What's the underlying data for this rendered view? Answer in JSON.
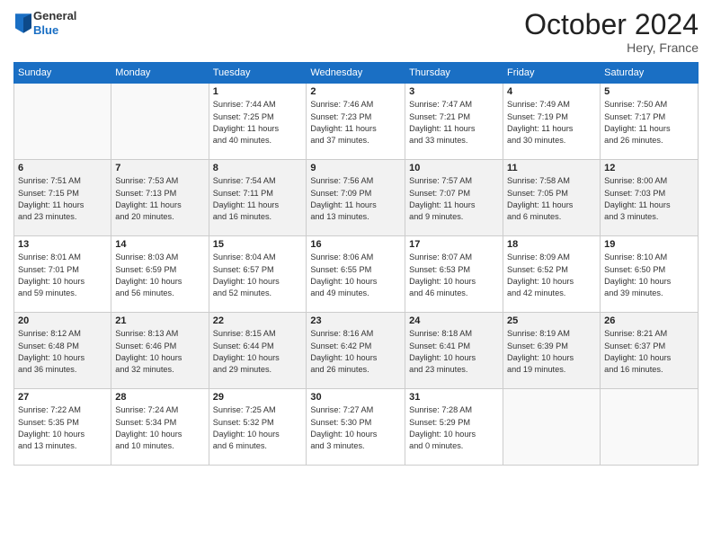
{
  "header": {
    "logo_line1": "General",
    "logo_line2": "Blue",
    "month_title": "October 2024",
    "location": "Hery, France"
  },
  "days_of_week": [
    "Sunday",
    "Monday",
    "Tuesday",
    "Wednesday",
    "Thursday",
    "Friday",
    "Saturday"
  ],
  "weeks": [
    [
      {
        "day": "",
        "info": ""
      },
      {
        "day": "",
        "info": ""
      },
      {
        "day": "1",
        "info": "Sunrise: 7:44 AM\nSunset: 7:25 PM\nDaylight: 11 hours\nand 40 minutes."
      },
      {
        "day": "2",
        "info": "Sunrise: 7:46 AM\nSunset: 7:23 PM\nDaylight: 11 hours\nand 37 minutes."
      },
      {
        "day": "3",
        "info": "Sunrise: 7:47 AM\nSunset: 7:21 PM\nDaylight: 11 hours\nand 33 minutes."
      },
      {
        "day": "4",
        "info": "Sunrise: 7:49 AM\nSunset: 7:19 PM\nDaylight: 11 hours\nand 30 minutes."
      },
      {
        "day": "5",
        "info": "Sunrise: 7:50 AM\nSunset: 7:17 PM\nDaylight: 11 hours\nand 26 minutes."
      }
    ],
    [
      {
        "day": "6",
        "info": "Sunrise: 7:51 AM\nSunset: 7:15 PM\nDaylight: 11 hours\nand 23 minutes."
      },
      {
        "day": "7",
        "info": "Sunrise: 7:53 AM\nSunset: 7:13 PM\nDaylight: 11 hours\nand 20 minutes."
      },
      {
        "day": "8",
        "info": "Sunrise: 7:54 AM\nSunset: 7:11 PM\nDaylight: 11 hours\nand 16 minutes."
      },
      {
        "day": "9",
        "info": "Sunrise: 7:56 AM\nSunset: 7:09 PM\nDaylight: 11 hours\nand 13 minutes."
      },
      {
        "day": "10",
        "info": "Sunrise: 7:57 AM\nSunset: 7:07 PM\nDaylight: 11 hours\nand 9 minutes."
      },
      {
        "day": "11",
        "info": "Sunrise: 7:58 AM\nSunset: 7:05 PM\nDaylight: 11 hours\nand 6 minutes."
      },
      {
        "day": "12",
        "info": "Sunrise: 8:00 AM\nSunset: 7:03 PM\nDaylight: 11 hours\nand 3 minutes."
      }
    ],
    [
      {
        "day": "13",
        "info": "Sunrise: 8:01 AM\nSunset: 7:01 PM\nDaylight: 10 hours\nand 59 minutes."
      },
      {
        "day": "14",
        "info": "Sunrise: 8:03 AM\nSunset: 6:59 PM\nDaylight: 10 hours\nand 56 minutes."
      },
      {
        "day": "15",
        "info": "Sunrise: 8:04 AM\nSunset: 6:57 PM\nDaylight: 10 hours\nand 52 minutes."
      },
      {
        "day": "16",
        "info": "Sunrise: 8:06 AM\nSunset: 6:55 PM\nDaylight: 10 hours\nand 49 minutes."
      },
      {
        "day": "17",
        "info": "Sunrise: 8:07 AM\nSunset: 6:53 PM\nDaylight: 10 hours\nand 46 minutes."
      },
      {
        "day": "18",
        "info": "Sunrise: 8:09 AM\nSunset: 6:52 PM\nDaylight: 10 hours\nand 42 minutes."
      },
      {
        "day": "19",
        "info": "Sunrise: 8:10 AM\nSunset: 6:50 PM\nDaylight: 10 hours\nand 39 minutes."
      }
    ],
    [
      {
        "day": "20",
        "info": "Sunrise: 8:12 AM\nSunset: 6:48 PM\nDaylight: 10 hours\nand 36 minutes."
      },
      {
        "day": "21",
        "info": "Sunrise: 8:13 AM\nSunset: 6:46 PM\nDaylight: 10 hours\nand 32 minutes."
      },
      {
        "day": "22",
        "info": "Sunrise: 8:15 AM\nSunset: 6:44 PM\nDaylight: 10 hours\nand 29 minutes."
      },
      {
        "day": "23",
        "info": "Sunrise: 8:16 AM\nSunset: 6:42 PM\nDaylight: 10 hours\nand 26 minutes."
      },
      {
        "day": "24",
        "info": "Sunrise: 8:18 AM\nSunset: 6:41 PM\nDaylight: 10 hours\nand 23 minutes."
      },
      {
        "day": "25",
        "info": "Sunrise: 8:19 AM\nSunset: 6:39 PM\nDaylight: 10 hours\nand 19 minutes."
      },
      {
        "day": "26",
        "info": "Sunrise: 8:21 AM\nSunset: 6:37 PM\nDaylight: 10 hours\nand 16 minutes."
      }
    ],
    [
      {
        "day": "27",
        "info": "Sunrise: 7:22 AM\nSunset: 5:35 PM\nDaylight: 10 hours\nand 13 minutes."
      },
      {
        "day": "28",
        "info": "Sunrise: 7:24 AM\nSunset: 5:34 PM\nDaylight: 10 hours\nand 10 minutes."
      },
      {
        "day": "29",
        "info": "Sunrise: 7:25 AM\nSunset: 5:32 PM\nDaylight: 10 hours\nand 6 minutes."
      },
      {
        "day": "30",
        "info": "Sunrise: 7:27 AM\nSunset: 5:30 PM\nDaylight: 10 hours\nand 3 minutes."
      },
      {
        "day": "31",
        "info": "Sunrise: 7:28 AM\nSunset: 5:29 PM\nDaylight: 10 hours\nand 0 minutes."
      },
      {
        "day": "",
        "info": ""
      },
      {
        "day": "",
        "info": ""
      }
    ]
  ]
}
